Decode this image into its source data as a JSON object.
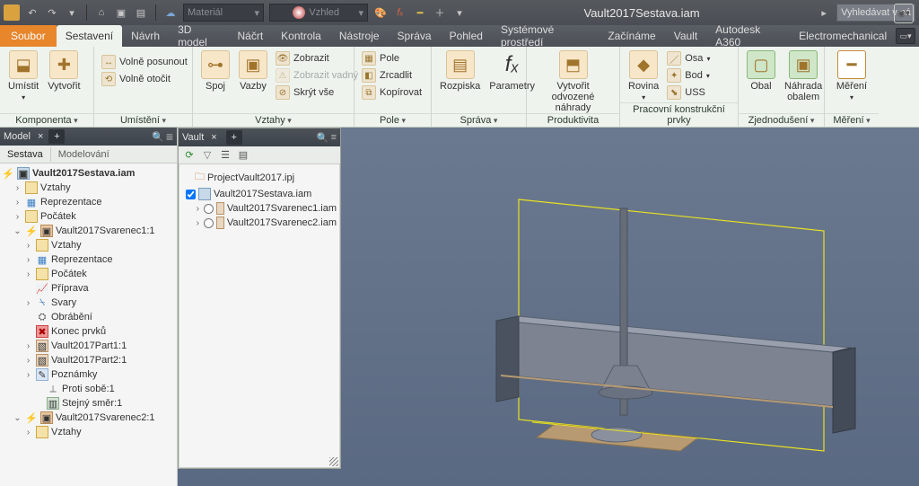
{
  "colors": {
    "accent": "#e8862c",
    "ribbon_bg": "#eef3ee"
  },
  "titlebar": {
    "material_placeholder": "Materiál",
    "appearance_placeholder": "Vzhled",
    "doc_title": "Vault2017Sestava.iam",
    "search_placeholder": "Vyhledávat v ná"
  },
  "tabs": {
    "file": "Soubor",
    "items": [
      "Sestavení",
      "Návrh",
      "3D model",
      "Náčrt",
      "Kontrola",
      "Nástroje",
      "Správa",
      "Pohled",
      "Systémové prostředí",
      "Začínáme",
      "Vault",
      "Autodesk A360",
      "Electromechanical"
    ],
    "active_index": 0
  },
  "ribbon": {
    "group_component": {
      "label": "Komponenta",
      "place": "Umístit",
      "create": "Vytvořit"
    },
    "group_position": {
      "label": "Umístění",
      "free_move": "Volně posunout",
      "free_rotate": "Volně otočit"
    },
    "group_relations": {
      "label": "Vztahy",
      "join": "Spoj",
      "constrain": "Vazby",
      "show": "Zobrazit",
      "show_bad": "Zobrazit vadný",
      "hide_all": "Skrýt vše"
    },
    "group_pattern": {
      "label": "Pole",
      "pattern": "Pole",
      "mirror": "Zrcadlit",
      "copy": "Kopírovat"
    },
    "group_manage": {
      "label": "Správa",
      "bom": "Rozpiska",
      "params": "Parametry"
    },
    "group_productivity": {
      "label": "Produktivita",
      "derive": "Vytvořit odvozené\nnáhrady"
    },
    "group_workfeat": {
      "label": "Pracovní konstrukční prvky",
      "plane": "Rovina",
      "axis": "Osa",
      "point": "Bod",
      "ucs": "USS"
    },
    "group_simplify": {
      "label": "Zjednodušení",
      "wrap": "Obal",
      "subst": "Náhrada\nobalem"
    },
    "group_measure": {
      "label": "Měření",
      "measure": "Měření"
    }
  },
  "model_panel": {
    "title": "Model",
    "subtabs": {
      "assembly": "Sestava",
      "modeling": "Modelování"
    },
    "root": "Vault2017Sestava.iam",
    "nodes": {
      "relations": "Vztahy",
      "representations": "Reprezentace",
      "origin": "Počátek",
      "sv1": "Vault2017Svarenec1:1",
      "sv1_prep": "Příprava",
      "sv1_welds": "Svary",
      "sv1_mach": "Obrábění",
      "sv1_eof": "Konec prvků",
      "part1": "Vault2017Part1:1",
      "part2": "Vault2017Part2:1",
      "notes": "Poznámky",
      "against": "Proti sobě:1",
      "same": "Stejný směr:1",
      "sv2": "Vault2017Svarenec2:1",
      "sv2_rel": "Vztahy"
    }
  },
  "vault_panel": {
    "title": "Vault",
    "project": "ProjectVault2017.ipj",
    "assembly": "Vault2017Sestava.iam",
    "child1": "Vault2017Svarenec1.iam",
    "child2": "Vault2017Svarenec2.iam"
  }
}
